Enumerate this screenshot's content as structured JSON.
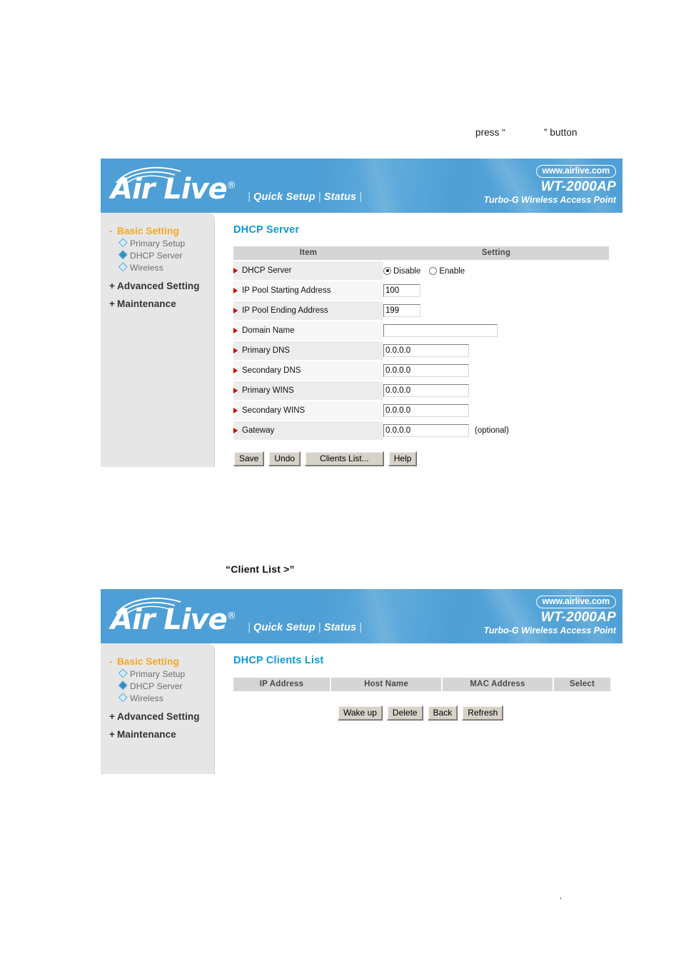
{
  "page": {
    "press_note_before": "press “",
    "press_note_after": "” button",
    "client_list_caption": "“Client List >”",
    "stray_mark": ","
  },
  "banner": {
    "logo_text": "Air Live",
    "logo_registered": "®",
    "nav": {
      "bar_left": "|",
      "quick_setup": "Quick Setup",
      "bar_mid": "|",
      "status": "Status",
      "bar_right": "|"
    },
    "url_pill": "www.airlive.com",
    "model_name": "WT-2000AP",
    "model_desc": "Turbo-G Wireless Access Point",
    "colors": {
      "banner_blue": "#4e9fd6",
      "title_blue": "#0c9ada",
      "accent_orange": "#f5a623",
      "arrow_red": "#d40000"
    }
  },
  "sidebar": {
    "groups": [
      {
        "sign": "-",
        "label": "Basic Setting",
        "active": true
      },
      {
        "sign": "+",
        "label": "Advanced Setting",
        "active": false
      },
      {
        "sign": "+",
        "label": "Maintenance",
        "active": false
      }
    ],
    "basic_items": [
      {
        "label": "Primary Setup",
        "current": false
      },
      {
        "label": "DHCP Server",
        "current": true
      },
      {
        "label": "Wireless",
        "current": false
      }
    ]
  },
  "dhcp_page": {
    "title": "DHCP Server",
    "columns": {
      "item": "Item",
      "setting": "Setting"
    },
    "rows": [
      {
        "label": "DHCP Server",
        "type": "radio",
        "options": [
          "Disable",
          "Enable"
        ],
        "selected": "Disable"
      },
      {
        "label": "IP Pool Starting Address",
        "type": "text",
        "value": "100",
        "width": "small"
      },
      {
        "label": "IP Pool Ending Address",
        "type": "text",
        "value": "199",
        "width": "small"
      },
      {
        "label": "Domain Name",
        "type": "text",
        "value": "",
        "width": "wide"
      },
      {
        "label": "Primary DNS",
        "type": "text",
        "value": "0.0.0.0",
        "width": "mid"
      },
      {
        "label": "Secondary DNS",
        "type": "text",
        "value": "0.0.0.0",
        "width": "mid"
      },
      {
        "label": "Primary WINS",
        "type": "text",
        "value": "0.0.0.0",
        "width": "mid"
      },
      {
        "label": "Secondary WINS",
        "type": "text",
        "value": "0.0.0.0",
        "width": "mid"
      },
      {
        "label": "Gateway",
        "type": "text",
        "value": "0.0.0.0",
        "width": "mid",
        "note": "(optional)"
      }
    ],
    "buttons": [
      {
        "label": "Save"
      },
      {
        "label": "Undo"
      },
      {
        "label": "Clients List..."
      },
      {
        "label": "Help"
      }
    ]
  },
  "clients_page": {
    "title": "DHCP Clients List",
    "columns": [
      "IP Address",
      "Host Name",
      "MAC Address",
      "Select"
    ],
    "rows": [],
    "buttons": [
      {
        "label": "Wake up"
      },
      {
        "label": "Delete"
      },
      {
        "label": "Back"
      },
      {
        "label": "Refresh"
      }
    ]
  }
}
